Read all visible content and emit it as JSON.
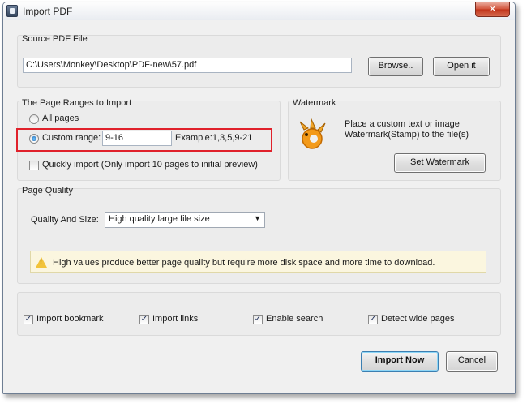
{
  "window": {
    "title": "Import PDF",
    "close_label": "✕"
  },
  "source": {
    "title": "Source PDF File",
    "path": "C:\\Users\\Monkey\\Desktop\\PDF-new\\57.pdf",
    "browse_label": "Browse..",
    "open_label": "Open it"
  },
  "ranges": {
    "title": "The Page Ranges to Import",
    "all_pages_label": "All pages",
    "custom_range_label": "Custom range:",
    "custom_range_value": "9-16",
    "example_label": "Example:1,3,5,9-21",
    "quick_import_label": "Quickly import (Only import 10 pages to  initial  preview)",
    "selected": "custom"
  },
  "watermark": {
    "title": "Watermark",
    "description_line1": "Place a custom text or image",
    "description_line2": "Watermark(Stamp) to the file(s)",
    "set_label": "Set Watermark",
    "icon": "gimp-logo-icon"
  },
  "quality": {
    "title": "Page Quality",
    "size_label": "Quality And Size:",
    "selected_option": "High quality large file size",
    "notice": "High values produce better page quality but require more disk space and more time to download."
  },
  "options": {
    "import_bookmark": {
      "label": "Import bookmark",
      "checked": true
    },
    "import_links": {
      "label": "Import links",
      "checked": true
    },
    "enable_search": {
      "label": "Enable search",
      "checked": true
    },
    "detect_wide_pages": {
      "label": "Detect wide pages",
      "checked": true
    }
  },
  "footer": {
    "import_label": "Import Now",
    "cancel_label": "Cancel"
  },
  "check_mark": "✓",
  "warning_mark": "!",
  "colors": {
    "highlight_border": "#e0212b",
    "accent": "#3c7fb1"
  }
}
